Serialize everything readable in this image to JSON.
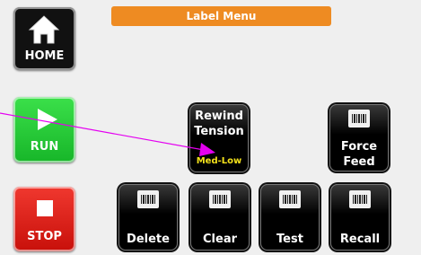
{
  "title": "Label Menu",
  "sidebar": {
    "home": "HOME",
    "run": "RUN",
    "stop": "STOP"
  },
  "buttons": {
    "rewind_line1": "Rewind",
    "rewind_line2": "Tension",
    "rewind_value": "Med-Low",
    "force_line1": "Force",
    "force_line2": "Feed",
    "delete": "Delete",
    "clear": "Clear",
    "test": "Test",
    "recall": "Recall"
  },
  "colors": {
    "title_bar": "#ee8b22",
    "run": "#21c935",
    "stop": "#e0241c",
    "value_text": "#f3e11b",
    "pointer": "#e400f0"
  }
}
